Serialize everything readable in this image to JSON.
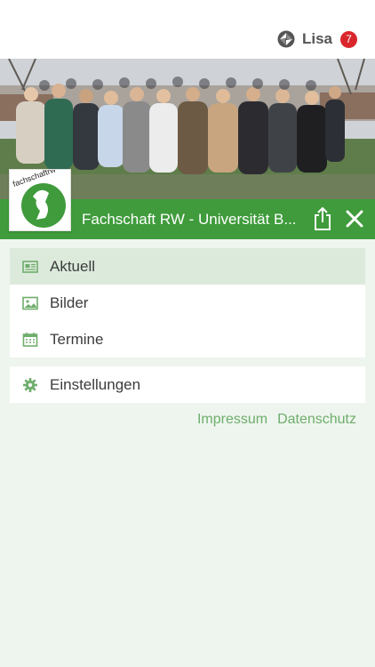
{
  "header": {
    "user_name": "Lisa",
    "notification_count": "7",
    "app_icon": "app-logo-icon"
  },
  "hero": {
    "image": "group-photo"
  },
  "title_bar": {
    "title": "Fachschaft RW - Universität B...",
    "logo_text": "fachschaftrw",
    "share_icon": "share-icon",
    "close_icon": "close-icon",
    "background_color": "#3f9b3b"
  },
  "menu": {
    "main_items": [
      {
        "label": "Aktuell",
        "icon": "newspaper-icon",
        "active": true
      },
      {
        "label": "Bilder",
        "icon": "image-icon",
        "active": false
      },
      {
        "label": "Termine",
        "icon": "calendar-icon",
        "active": false
      }
    ],
    "settings_item": {
      "label": "Einstellungen",
      "icon": "gear-icon"
    }
  },
  "footer": {
    "links": [
      "Impressum",
      "Datenschutz"
    ]
  },
  "colors": {
    "accent": "#3f9b3b",
    "active_row": "#dceadb",
    "link": "#6fae6c",
    "badge": "#d9262c",
    "background": "#eef5ee"
  }
}
